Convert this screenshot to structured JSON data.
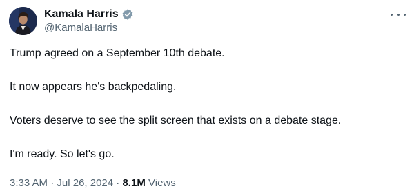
{
  "author": {
    "name": "Kamala Harris",
    "handle": "@KamalaHarris",
    "verified_badge_color": "#829aab"
  },
  "tweet": {
    "paragraphs": [
      "Trump agreed on a September 10th debate.",
      "It now appears he's backpedaling.",
      "Voters deserve to see the split screen that exists on a debate stage.",
      "I'm ready. So let's go."
    ],
    "time": "3:33 AM",
    "separator": "·",
    "date": "Jul 26, 2024",
    "views_count": "8.1M",
    "views_label": "Views"
  },
  "icons": {
    "avatar": "profile-photo",
    "verified": "verified-badge-icon",
    "more": "more-options-icon"
  }
}
